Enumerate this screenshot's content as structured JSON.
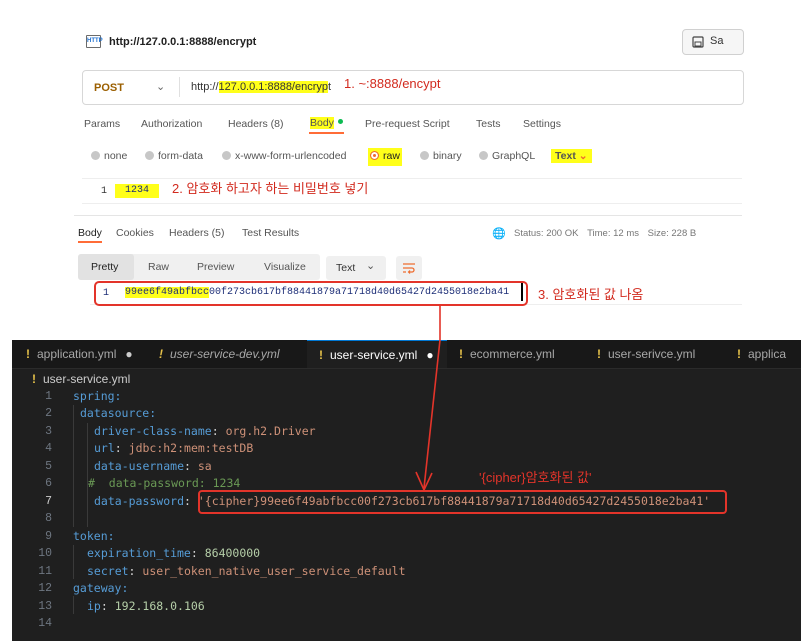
{
  "postman": {
    "url_title": "http://127.0.0.1:8888/encrypt",
    "http_icon": "HTTP",
    "save_label": "Sa",
    "method": "POST",
    "url_prefix": "http://",
    "url_highlight": "127.0.0.1:8888/encryp",
    "url_suffix": "t",
    "ann1": "1. ~:8888/encypt",
    "req_tabs": [
      {
        "label": "Params"
      },
      {
        "label": "Authorization"
      },
      {
        "label": "Headers (8)"
      },
      {
        "label": "Body"
      },
      {
        "label": "Pre-request Script"
      },
      {
        "label": "Tests"
      },
      {
        "label": "Settings"
      }
    ],
    "body_options": [
      "none",
      "form-data",
      "x-www-form-urlencoded",
      "raw",
      "binary",
      "GraphQL"
    ],
    "raw_type": "Text",
    "req_line_no": "1",
    "req_body": "1234",
    "ann2": "2. 암호화 하고자 하는 비밀번호 넣기",
    "resp_tabs": [
      "Body",
      "Cookies",
      "Headers (5)",
      "Test Results"
    ],
    "status": "Status: 200 OK",
    "time": "Time: 12 ms",
    "size": "Size: 228 B",
    "view_tabs": [
      "Pretty",
      "Raw",
      "Preview",
      "Visualize"
    ],
    "resp_type": "Text",
    "resp_line_no": "1",
    "resp_hl": "99ee6f49abfbcc",
    "resp_rest": "00f273cb617bf88441879a71718d40d65427d2455018e2ba41",
    "ann3": "3. 암호화된 값 나옴"
  },
  "editor": {
    "tabs": [
      {
        "label": "application.yml"
      },
      {
        "label": "user-service-dev.yml"
      },
      {
        "label": "user-service.yml"
      },
      {
        "label": "ecommerce.yml"
      },
      {
        "label": "user-serivce.yml"
      },
      {
        "label": "applica"
      }
    ],
    "breadcrumb": "user-service.yml",
    "annotation": "'{cipher}암호화된 값'",
    "code": {
      "l1": "spring:",
      "l2": "datasource:",
      "l3k": "driver-class-name",
      "l3v": "org.h2.Driver",
      "l4k": "url",
      "l4v": "jdbc:h2:mem:testDB",
      "l5k": "data-username",
      "l5v": "sa",
      "l6": "#  data-password: 1234",
      "l7k": "data-password",
      "l7v": "'{cipher}99ee6f49abfbcc00f273cb617bf88441879a71718d40d65427d2455018e2ba41'",
      "l9": "token:",
      "l10k": "expiration_time",
      "l10v": "86400000",
      "l11k": "secret",
      "l11v": "user_token_native_user_service_default",
      "l12": "gateway:",
      "l13k": "ip",
      "l13v": "192.168.0.106"
    },
    "line_numbers": [
      "1",
      "2",
      "3",
      "4",
      "5",
      "6",
      "7",
      "8",
      "9",
      "10",
      "11",
      "12",
      "13",
      "14"
    ]
  }
}
